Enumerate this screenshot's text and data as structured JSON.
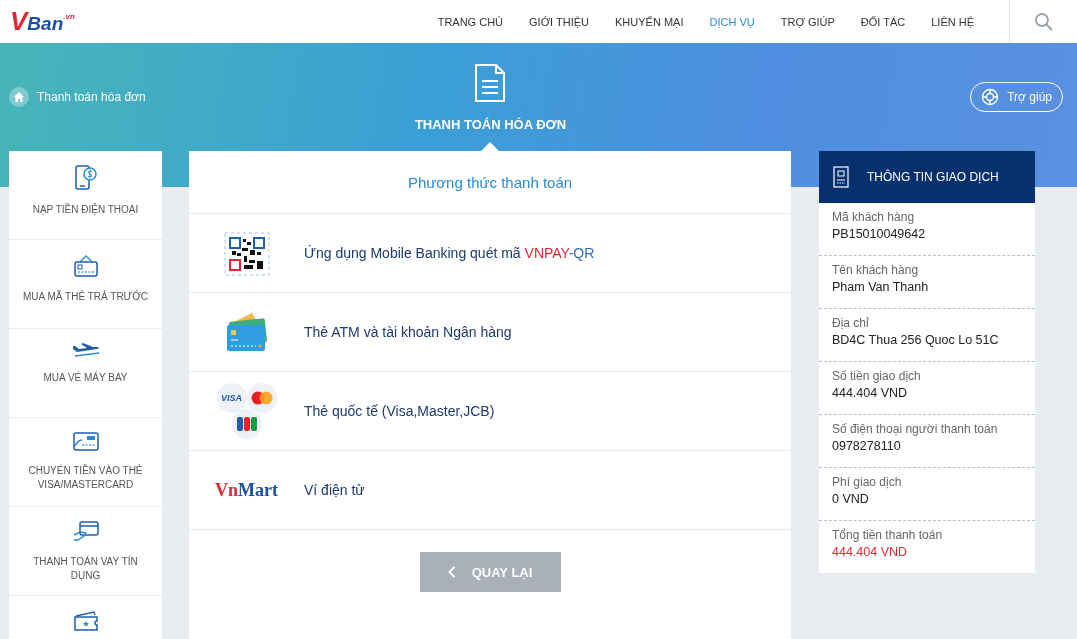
{
  "logo": {
    "mark": "V",
    "name": "Ban",
    "suffix": ".vn"
  },
  "nav": [
    {
      "label": "TRANG CHỦ",
      "selected": false
    },
    {
      "label": "GIỚI THIỆU",
      "selected": false
    },
    {
      "label": "KHUYẾN MẠI",
      "selected": false
    },
    {
      "label": "DỊCH VỤ",
      "selected": true
    },
    {
      "label": "TRỢ GIÚP",
      "selected": false
    },
    {
      "label": "ĐỐI TÁC",
      "selected": false
    },
    {
      "label": "LIÊN HỆ",
      "selected": false
    }
  ],
  "breadcrumb": "Thanh toán hóa đơn",
  "page_title": "THANH TOÁN HÓA ĐƠN",
  "help_button": "Trợ giúp",
  "sidebar": [
    {
      "kind": "phone",
      "label": "NẠP TIỀN ĐIỆN THOẠI"
    },
    {
      "kind": "card",
      "label": "MUA MÃ THẺ TRẢ TRƯỚC"
    },
    {
      "kind": "plane",
      "label": "MUA VÉ MÁY BAY"
    },
    {
      "kind": "visa",
      "label": "CHUYỂN TIỀN VÀO THẺ VISA/MASTERCARD"
    },
    {
      "kind": "loan",
      "label": "THANH TOÁN VAY TÍN DỤNG"
    },
    {
      "kind": "ticket"
    }
  ],
  "methods": {
    "title": "Phương thức thanh toán",
    "items": [
      {
        "kind": "qr",
        "parts": [
          {
            "text": "Ứng dụng Mobile Banking quét mã ",
            "color": "#1c3a6e"
          },
          {
            "text": "VNPAY",
            "color": "#e32636"
          },
          {
            "text": "-QR",
            "color": "#2a6cc0"
          }
        ]
      },
      {
        "kind": "atm",
        "parts": [
          {
            "text": "Thẻ ATM và tài khoản Ngân hàng",
            "color": "#1c3a6e"
          }
        ]
      },
      {
        "kind": "intl",
        "logo_text": "VISA",
        "parts": [
          {
            "text": "Thẻ quốc tế (Visa,Master,JCB)",
            "color": "#1c3a6e"
          }
        ]
      },
      {
        "kind": "wallet",
        "logo_parts": [
          "Vn",
          "Mart"
        ],
        "parts": [
          {
            "text": "Ví điện tử",
            "color": "#1c3a6e"
          }
        ]
      }
    ],
    "back_button": "QUAY LẠI"
  },
  "transaction": {
    "title": "THÔNG TIN GIAO DỊCH",
    "rows": [
      {
        "label": "Mã khách hàng",
        "value": "PB15010049642",
        "highlight": false
      },
      {
        "label": "Tên khách hàng",
        "value": "Pham Van Thanh",
        "highlight": false
      },
      {
        "label": "Địa chỉ",
        "value": "BD4C Thua 256 Quoc Lo 51C",
        "highlight": false
      },
      {
        "label": "Số tiền giao dịch",
        "value": "444.404 VND",
        "highlight": false
      },
      {
        "label": "Số điện thoại người thanh toán",
        "value": "0978278110",
        "highlight": false
      },
      {
        "label": "Phí giao dịch",
        "value": "0 VND",
        "highlight": false
      },
      {
        "label": "Tổng tiền thanh toán",
        "value": "444.404 VND",
        "highlight": true
      }
    ]
  }
}
